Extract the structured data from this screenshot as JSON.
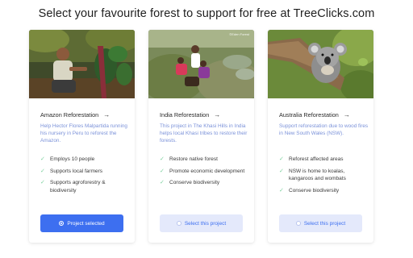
{
  "heading": "Select your favourite forest to support for free at TreeClicks.com",
  "colors": {
    "accent": "#3d6ff0",
    "description": "#7b92d9",
    "check": "#7fd2a0",
    "button_unselected_bg": "#e4e9fb"
  },
  "cards": [
    {
      "title": "Amazon Reforestation",
      "arrow_icon": "arrow-right-icon",
      "description": "Help Hector Flores Malpartida running his nursery in Peru to reforest the Amazon.",
      "features": [
        "Employs 10 people",
        "Supports local farmers",
        "Supports agroforestry & biodiversity"
      ],
      "button_label": "Project selected",
      "selected": true
    },
    {
      "title": "India Reforestation",
      "arrow_icon": "arrow-right-icon",
      "photo_credit": "©Eden Forest",
      "description": "This project in The Khasi Hills in India helps local Khasi tribes to restore their forests.",
      "features": [
        "Restore native forest",
        "Promote economic development",
        "Conserve biodiversity"
      ],
      "button_label": "Select this project",
      "selected": false
    },
    {
      "title": "Australia Reforestation",
      "arrow_icon": "arrow-right-icon",
      "description": "Support reforestation due to wood fires in New South Wales (NSW).",
      "features": [
        "Reforest affected areas",
        "NSW is home to koalas, kangaroos and wombats",
        "Conserve biodiversity"
      ],
      "button_label": "Select this project",
      "selected": false
    }
  ]
}
